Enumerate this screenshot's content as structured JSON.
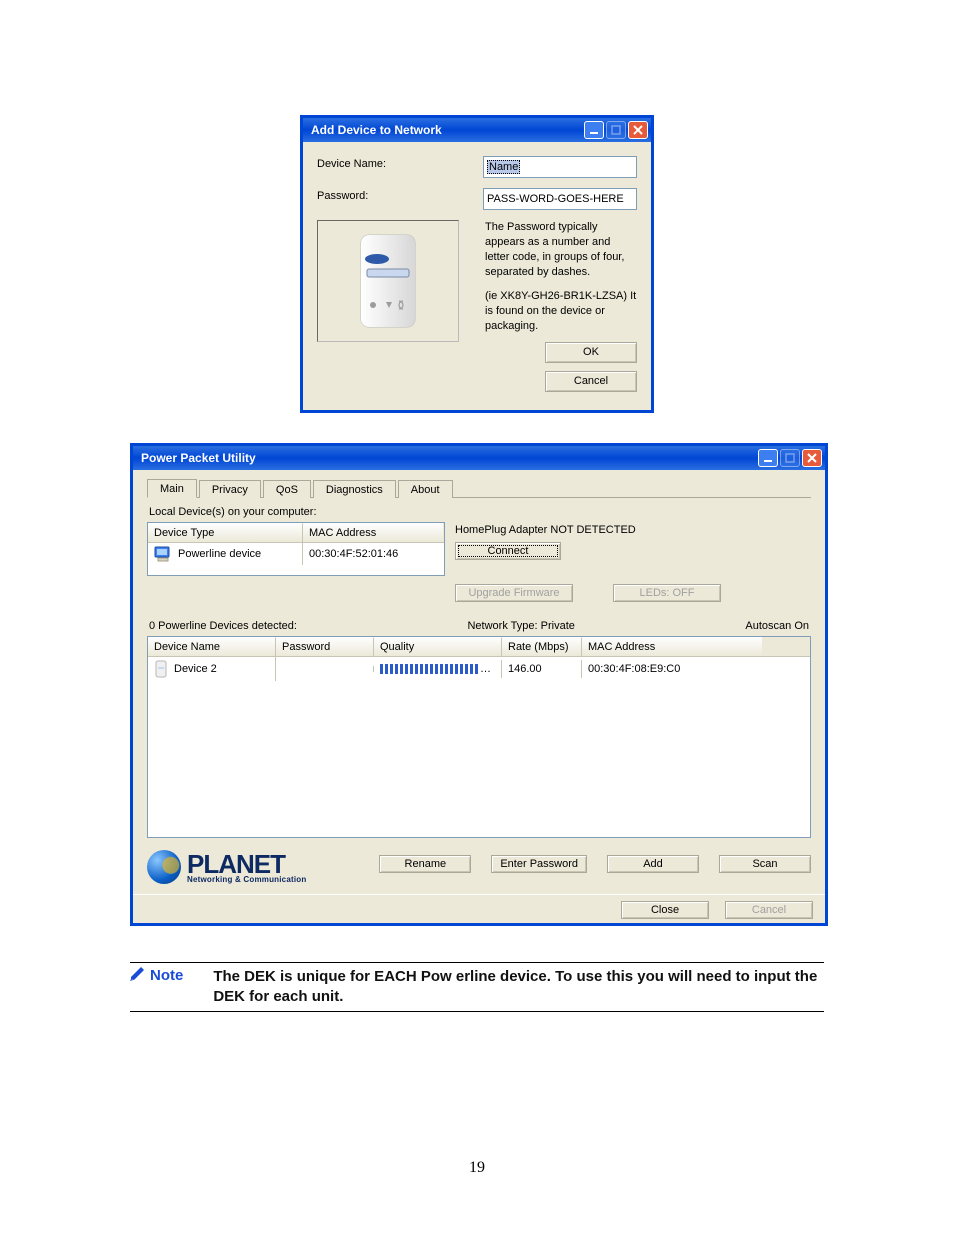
{
  "dlg_add": {
    "title": "Add Device to Network",
    "device_name_label": "Device Name:",
    "device_name_value": "Name",
    "password_label": "Password:",
    "password_value": "PASS-WORD-GOES-HERE",
    "hint1": "The Password typically appears as a number and letter code, in groups of four, separated by dashes.",
    "hint2": "(ie XK8Y-GH26-BR1K-LZSA) It is found on the device or packaging.",
    "ok": "OK",
    "cancel": "Cancel"
  },
  "pp": {
    "title": "Power Packet Utility",
    "tabs": {
      "main": "Main",
      "privacy": "Privacy",
      "qos": "QoS",
      "diagnostics": "Diagnostics",
      "about": "About"
    },
    "local_label": "Local Device(s) on your computer:",
    "col_device_type": "Device Type",
    "col_mac": "MAC Address",
    "local_row": {
      "type": "Powerline device",
      "mac": "00:30:4F:52:01:46"
    },
    "status": "HomePlug Adapter NOT DETECTED",
    "connect": "Connect",
    "upgrade": "Upgrade Firmware",
    "leds": "LEDs:   OFF",
    "detected_line": "0 Powerline Devices detected:",
    "network_type": "Network Type: Private",
    "autoscan": "Autoscan On",
    "cols": {
      "name": "Device Name",
      "pwd": "Password",
      "quality": "Quality",
      "rate": "Rate (Mbps)",
      "mac": "MAC Address"
    },
    "row": {
      "name": "Device 2",
      "rate": "146.00",
      "mac": "00:30:4F:08:E9:C0"
    },
    "logo_tag": "Networking & Communication",
    "logo_big": "PLANET",
    "btn_rename": "Rename",
    "btn_enterpwd": "Enter Password",
    "btn_add": "Add",
    "btn_scan": "Scan",
    "btn_close": "Close",
    "btn_cancel": "Cancel"
  },
  "note": {
    "label": "Note",
    "text": "The DEK is unique for EACH Pow erline device.  To use this you will need to input the DEK for each unit."
  },
  "page_number": "19"
}
